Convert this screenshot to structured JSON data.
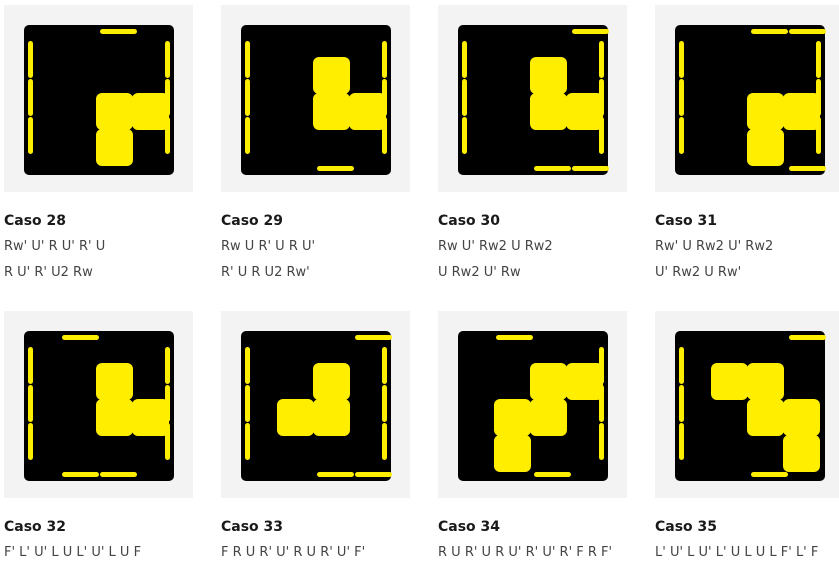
{
  "cases": [
    {
      "title": "Caso 28",
      "alg": [
        "Rw' U' R U' R' U",
        "R U' R' U2 Rw"
      ],
      "top": [
        0,
        0,
        0,
        0,
        1,
        1,
        0,
        1,
        0
      ],
      "edges": {
        "top": [
          0,
          1,
          0
        ],
        "bottom": [
          0,
          0,
          0
        ],
        "left": [
          1,
          1,
          1
        ],
        "right": [
          1,
          1,
          1
        ]
      }
    },
    {
      "title": "Caso 29",
      "alg": [
        "Rw U R' U R U'",
        "R' U R U2 Rw'"
      ],
      "top": [
        0,
        1,
        0,
        0,
        1,
        1,
        0,
        0,
        0
      ],
      "edges": {
        "top": [
          0,
          0,
          0
        ],
        "bottom": [
          0,
          1,
          0
        ],
        "left": [
          1,
          1,
          1
        ],
        "right": [
          1,
          1,
          1
        ]
      }
    },
    {
      "title": "Caso 30",
      "alg": [
        "Rw U' Rw2 U Rw2",
        "U Rw2 U' Rw"
      ],
      "top": [
        0,
        1,
        0,
        0,
        1,
        1,
        0,
        0,
        0
      ],
      "edges": {
        "top": [
          0,
          0,
          1
        ],
        "bottom": [
          0,
          1,
          1
        ],
        "left": [
          1,
          1,
          1
        ],
        "right": [
          1,
          1,
          1
        ]
      }
    },
    {
      "title": "Caso 31",
      "alg": [
        "Rw' U Rw2 U' Rw2",
        "U' Rw2 U Rw'"
      ],
      "top": [
        0,
        0,
        0,
        0,
        1,
        1,
        0,
        1,
        0
      ],
      "edges": {
        "top": [
          0,
          1,
          1
        ],
        "bottom": [
          0,
          0,
          1
        ],
        "left": [
          1,
          1,
          1
        ],
        "right": [
          1,
          1,
          1
        ]
      }
    },
    {
      "title": "Caso 32",
      "alg": [
        "F' L' U' L U L' U' L U F",
        ""
      ],
      "top": [
        0,
        1,
        0,
        0,
        1,
        1,
        0,
        0,
        0
      ],
      "edges": {
        "top": [
          1,
          0,
          0
        ],
        "bottom": [
          1,
          1,
          0
        ],
        "left": [
          1,
          1,
          1
        ],
        "right": [
          1,
          1,
          1
        ]
      }
    },
    {
      "title": "Caso 33",
      "alg": [
        "F R U R' U' R U R' U' F'",
        ""
      ],
      "top": [
        0,
        1,
        0,
        1,
        1,
        0,
        0,
        0,
        0
      ],
      "edges": {
        "top": [
          0,
          0,
          1
        ],
        "bottom": [
          0,
          1,
          1
        ],
        "left": [
          1,
          1,
          1
        ],
        "right": [
          1,
          1,
          1
        ]
      }
    },
    {
      "title": "Caso 34",
      "alg": [
        "R U R' U R U' R' U' R' F R F'",
        ""
      ],
      "top": [
        0,
        1,
        1,
        1,
        1,
        0,
        1,
        0,
        0
      ],
      "edges": {
        "top": [
          1,
          0,
          0
        ],
        "bottom": [
          0,
          1,
          0
        ],
        "left": [
          0,
          0,
          0
        ],
        "right": [
          1,
          1,
          1
        ]
      }
    },
    {
      "title": "Caso 35",
      "alg": [
        "L' U' L U' L' U L U L F' L' F",
        ""
      ],
      "top": [
        1,
        1,
        0,
        0,
        1,
        1,
        0,
        0,
        1
      ],
      "edges": {
        "top": [
          0,
          0,
          1
        ],
        "bottom": [
          0,
          1,
          0
        ],
        "left": [
          1,
          1,
          1
        ],
        "right": [
          0,
          0,
          0
        ]
      }
    }
  ],
  "colors": {
    "sticker": "#ffee00",
    "face": "#000000",
    "card": "#f3f3f3"
  }
}
